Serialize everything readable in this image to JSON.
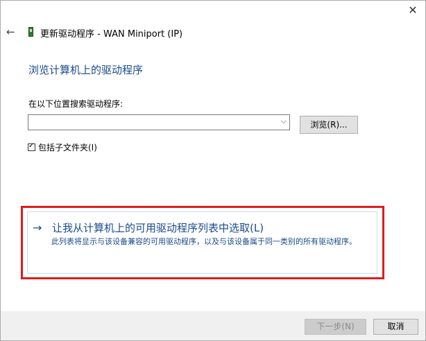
{
  "window": {
    "close_label": "✕",
    "title": "更新驱动程序 - WAN Miniport (IP)"
  },
  "header": {
    "heading": "浏览计算机上的驱动程序"
  },
  "search": {
    "label": "在以下位置搜索驱动程序:",
    "path_value": "",
    "browse_label": "浏览(R)...",
    "include_subfolders_label": "包括子文件夹(I)",
    "include_subfolders_checked": true
  },
  "option": {
    "title": "让我从计算机上的可用驱动程序列表中选取(L)",
    "description": "此列表将显示与该设备兼容的可用驱动程序，以及与该设备属于同一类别的所有驱动程序。"
  },
  "footer": {
    "next_label": "下一步(N)",
    "cancel_label": "取消"
  },
  "colors": {
    "accent_blue": "#1a4a8c",
    "highlight_red": "#e01b1b"
  },
  "icons": [
    "back-arrow-icon",
    "device-icon",
    "chevron-down-icon",
    "right-arrow-icon",
    "close-icon"
  ]
}
